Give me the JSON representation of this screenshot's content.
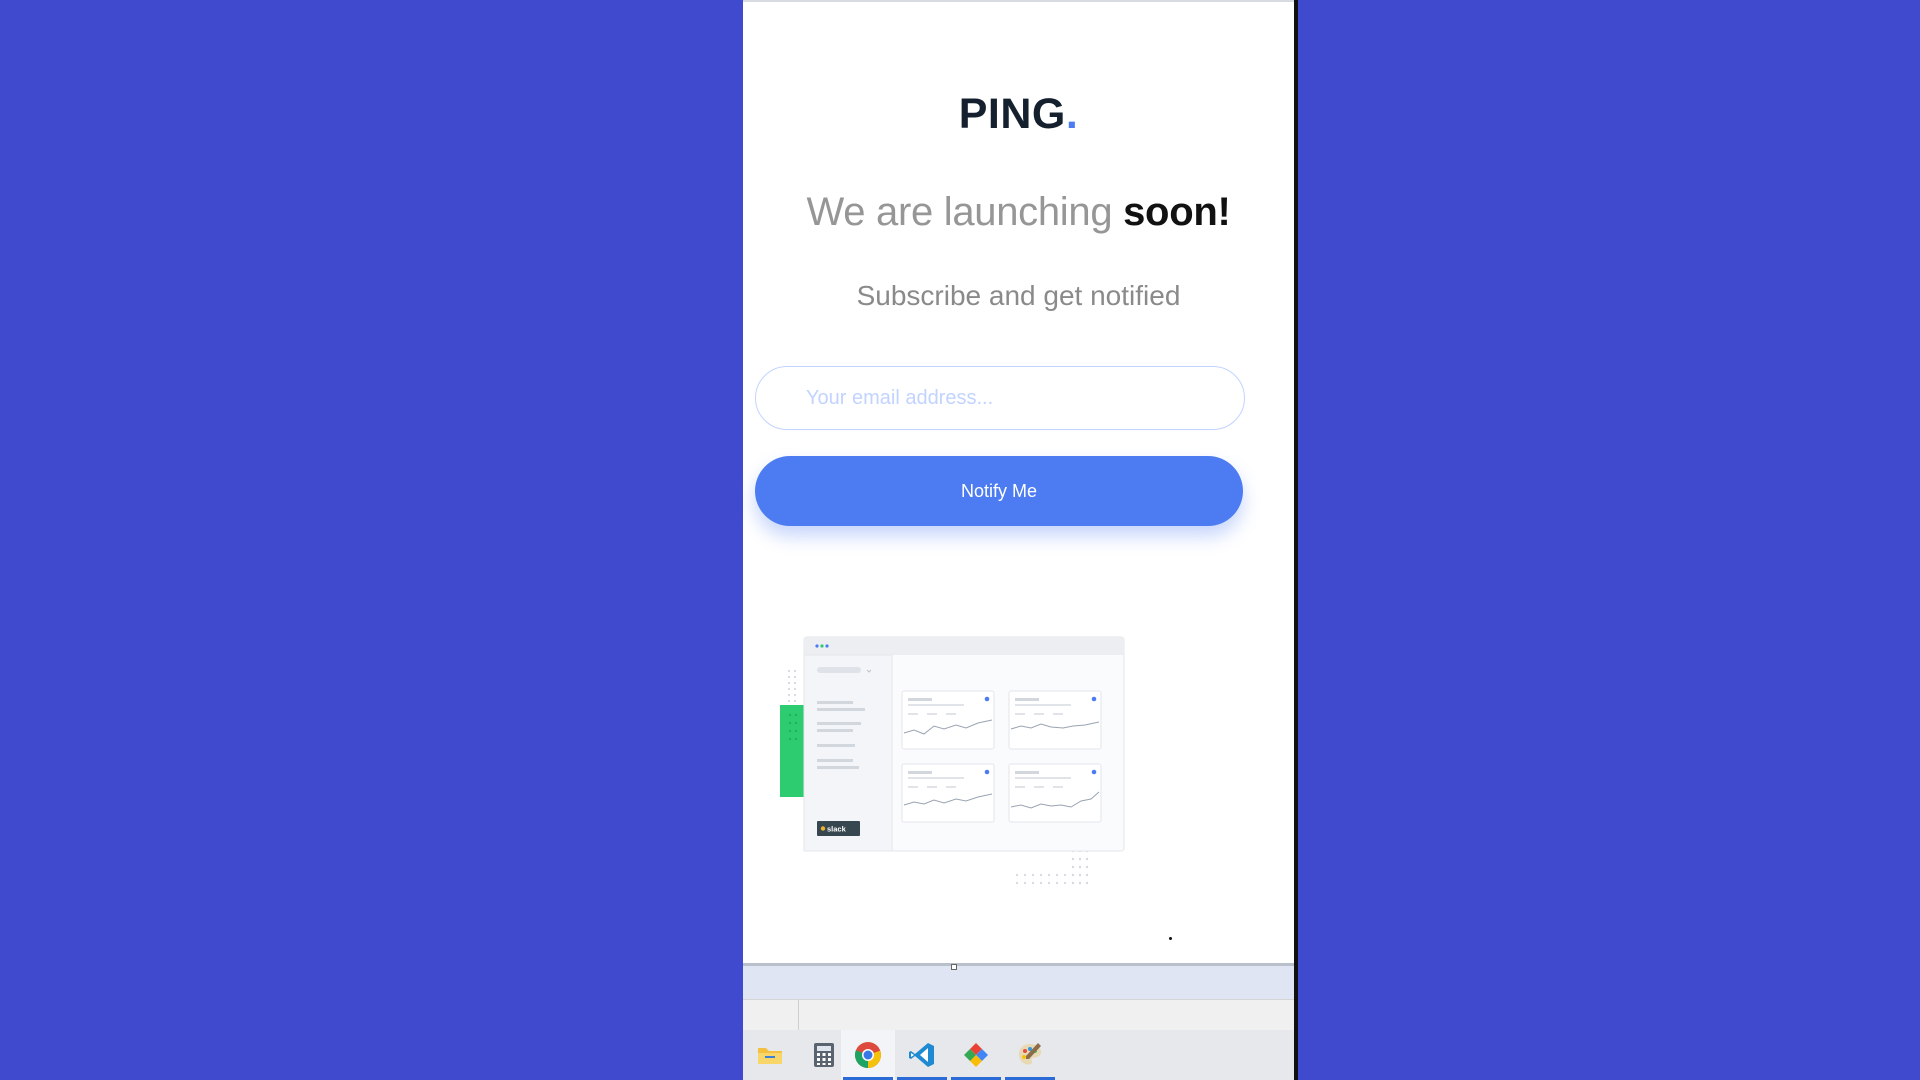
{
  "brand": {
    "name": "PING",
    "dot": "."
  },
  "headline": {
    "light": "We are launching ",
    "bold": "soon!"
  },
  "subline": "Subscribe and get notified",
  "form": {
    "email_placeholder": "Your email address...",
    "email_value": "",
    "button_label": "Notify Me"
  },
  "illustration": {
    "badge_label": "slack"
  },
  "colors": {
    "background": "#3f4acf",
    "accent": "#4d7cf2",
    "input_border": "#c2d3ff",
    "brand_text": "#15202e"
  },
  "taskbar": {
    "items": [
      {
        "name": "file-explorer-icon",
        "active": false
      },
      {
        "name": "calculator-icon",
        "active": false
      },
      {
        "name": "chrome-icon",
        "active": true
      },
      {
        "name": "vscode-icon",
        "active": true
      },
      {
        "name": "app-diamond-icon",
        "active": true
      },
      {
        "name": "paint-palette-icon",
        "active": true
      }
    ]
  }
}
